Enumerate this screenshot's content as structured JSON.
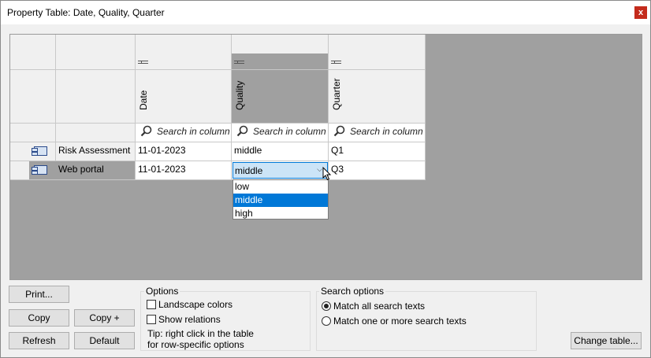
{
  "window": {
    "title": "Property Table: Date, Quality, Quarter",
    "close_glyph": "x"
  },
  "table": {
    "columns": [
      {
        "label": "Date",
        "search_placeholder": "Search in column"
      },
      {
        "label": "Quality",
        "search_placeholder": "Search in column"
      },
      {
        "label": "Quarter",
        "search_placeholder": "Search in column"
      }
    ],
    "rows": [
      {
        "name": "Risk Assessment",
        "icon": "component-icon",
        "date": "11-01-2023",
        "quality": "middle",
        "quarter": "Q1"
      },
      {
        "name": "Web portal",
        "icon": "component-icon",
        "date": "11-01-2023",
        "quality": "middle",
        "quarter": "Q3"
      }
    ]
  },
  "dropdown": {
    "selected": "middle",
    "options": [
      "low",
      "middle",
      "high"
    ],
    "highlighted": "middle"
  },
  "buttons": {
    "print": "Print...",
    "copy": "Copy",
    "copy_plus": "Copy +",
    "refresh": "Refresh",
    "default": "Default",
    "change_table": "Change table..."
  },
  "options": {
    "title": "Options",
    "landscape_colors": "Landscape colors",
    "show_relations": "Show relations",
    "tip_line1": "Tip: right click in the table",
    "tip_line2": "for row-specific options"
  },
  "search_options": {
    "title": "Search options",
    "match_all": "Match all search texts",
    "match_one": "Match one or more search texts"
  },
  "colors": {
    "selection": "#0078d7",
    "grid_bg": "#a0a0a0"
  }
}
